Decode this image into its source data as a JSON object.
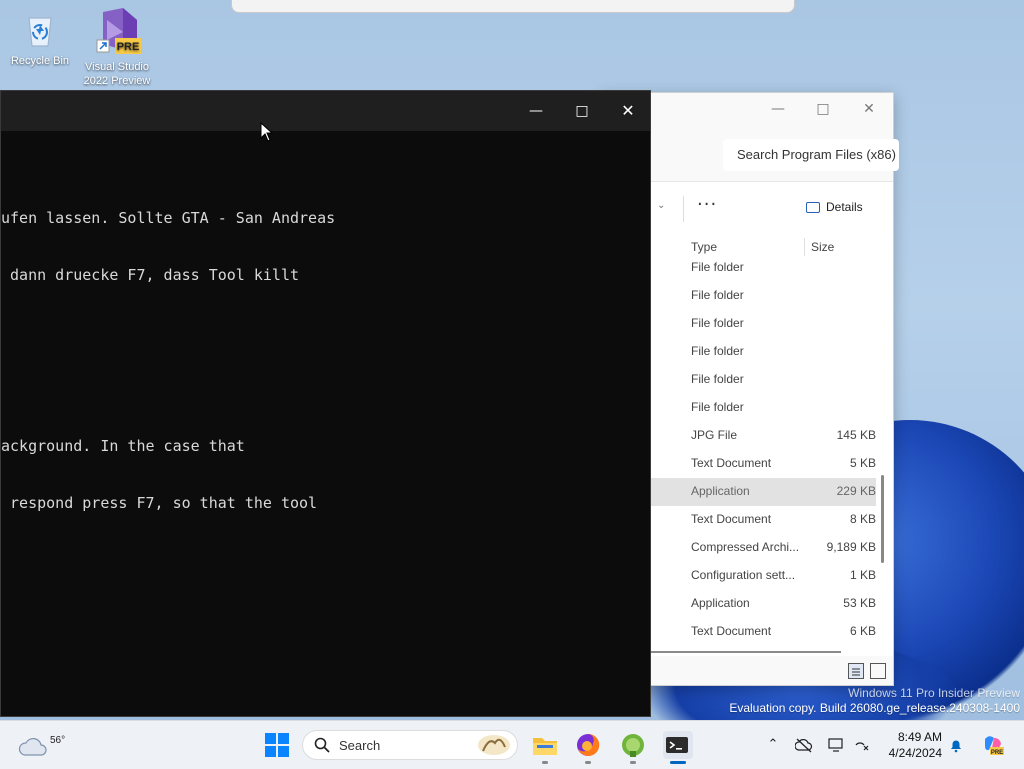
{
  "desktop": {
    "icons": [
      {
        "label_line1": "Recycle Bin",
        "label_line2": ""
      },
      {
        "label_line1": "Visual Studio",
        "label_line2": "2022 Preview",
        "badge": "PRE"
      }
    ]
  },
  "explorer": {
    "search_placeholder": "Search Program Files (x86)",
    "toolbar": {
      "more_label": "···",
      "details_label": "Details"
    },
    "columns": {
      "type": "Type",
      "size": "Size"
    },
    "rows": [
      {
        "type": "File folder",
        "size": ""
      },
      {
        "type": "File folder",
        "size": ""
      },
      {
        "type": "File folder",
        "size": ""
      },
      {
        "type": "File folder",
        "size": ""
      },
      {
        "type": "File folder",
        "size": ""
      },
      {
        "type": "File folder",
        "size": ""
      },
      {
        "type": "JPG File",
        "size": "145 KB"
      },
      {
        "type": "Text Document",
        "size": "5 KB"
      },
      {
        "type": "Application",
        "size": "229 KB",
        "selected": true
      },
      {
        "type": "Text Document",
        "size": "8 KB"
      },
      {
        "type": "Compressed Archi...",
        "size": "9,189 KB"
      },
      {
        "type": "Configuration sett...",
        "size": "1 KB"
      },
      {
        "type": "Application",
        "size": "53 KB"
      },
      {
        "type": "Text Document",
        "size": "6 KB"
      }
    ]
  },
  "terminal": {
    "lines": [
      "ufen lassen. Sollte GTA - San Andreas",
      " dann druecke F7, dass Tool killt",
      "",
      "",
      "ackground. In the case that",
      " respond press F7, so that the tool"
    ]
  },
  "watermark": {
    "line1": "Windows 11 Pro Insider Preview",
    "line2": "Evaluation copy. Build 26080.ge_release.240308-1400"
  },
  "taskbar": {
    "weather_temp": "56°",
    "search_label": "Search",
    "clock_time": "8:49 AM",
    "clock_date": "4/24/2024"
  },
  "colors": {
    "accent": "#0067c0",
    "terminal_bg": "#0c0c0c",
    "terminal_text": "#d9d9d9"
  }
}
